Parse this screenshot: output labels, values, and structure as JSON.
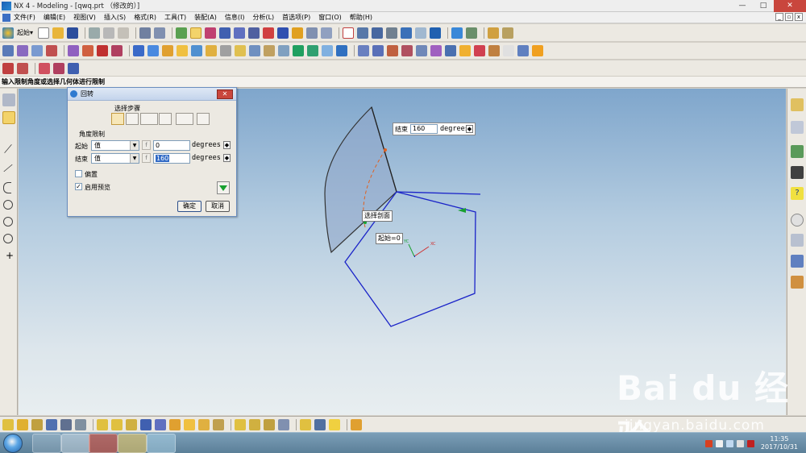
{
  "window": {
    "title": "NX 4 - Modeling - [qwq.prt （修改的）]",
    "controls": [
      "—",
      "□",
      "✕"
    ]
  },
  "menu": {
    "items": [
      "文件(F)",
      "编辑(E)",
      "视图(V)",
      "插入(S)",
      "格式(R)",
      "工具(T)",
      "装配(A)",
      "信息(I)",
      "分析(L)",
      "首选项(P)",
      "窗口(O)",
      "帮助(H)"
    ]
  },
  "toolbar": {
    "start_label": "起始"
  },
  "cue_line": "输入限制角度或选择几何体进行限制",
  "dialog": {
    "title": "回转",
    "close": "✕",
    "selection_steps_label": "选择步骤",
    "angle_limits_label": "角度限制",
    "start_label": "起始",
    "start_type": "值",
    "start_value": "0",
    "end_label": "结束",
    "end_type": "值",
    "end_value": "160",
    "unit": "degrees",
    "offset_label": "偏置",
    "offset_checked": "",
    "preview_label": "启用预览",
    "preview_checked": "✓",
    "ok_label": "确定",
    "cancel_label": "取消"
  },
  "viewport": {
    "end_handle_label": "结束",
    "end_handle_value": "160",
    "end_handle_unit": "degrees",
    "select_section_label": "选择剖面",
    "start_handle_label": "起始=0"
  },
  "watermark": {
    "brand": "Bai du 经验",
    "url": "jingyan.baidu.com"
  },
  "taskbar": {
    "time": "11:35",
    "date": "2017/10/31"
  },
  "colors": {
    "sketch": "#1a23c8",
    "surface": "#8fa6c8",
    "accent": "#c9463d"
  }
}
